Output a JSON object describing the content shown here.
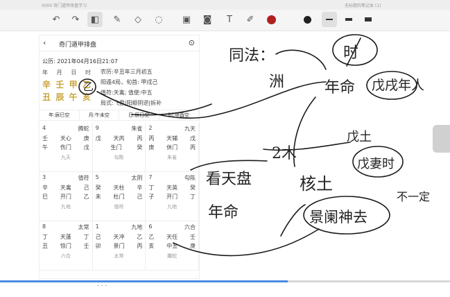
{
  "status_bar": {
    "left_text": "0000 奇门遁甲排盘学习",
    "right_text": "无标题的笔记本 (1)"
  },
  "app": {
    "title": "奇门遁甲排盘",
    "date_line": "公历: 2021年04月16日21:07",
    "pillar_labels": [
      "年",
      "月",
      "日",
      "时"
    ],
    "stems": [
      "辛",
      "壬",
      "甲",
      "乙"
    ],
    "branches": [
      "丑",
      "辰",
      "午",
      "亥"
    ],
    "info_lines": [
      "农历:辛丑年三月初五",
      "阳遁4局，旬首: 甲戌己",
      "值符:天禽; 值使:中五",
      "局式:飞盘|阳顺阴逆|拆补"
    ],
    "kong": [
      "年:辰巳空",
      "月:午未空",
      "日:辰巳空",
      "时:申酉空"
    ],
    "palaces": [
      {
        "num": "4",
        "god": "腾蛇",
        "r2": [
          "壬",
          "天心",
          "庚"
        ],
        "r3": [
          "午",
          "伤门",
          "戊"
        ],
        "foot": "九天"
      },
      {
        "num": "9",
        "god": "朱雀",
        "r2": [
          "戊",
          "天芮",
          "丙"
        ],
        "r3": [
          "",
          "生门",
          "癸"
        ],
        "foot": "勾陈"
      },
      {
        "num": "2",
        "god": "九天",
        "r2": [
          "丙",
          "天辅",
          "戊"
        ],
        "r3": [
          "庚",
          "休门",
          "丙"
        ],
        "foot": "朱雀"
      },
      {
        "num": "3",
        "god": "值符",
        "r2": [
          "辛",
          "天禽",
          "己"
        ],
        "r3": [
          "巳",
          "开门",
          "乙"
        ],
        "foot": "九地"
      },
      {
        "num": "5",
        "god": "太阴",
        "r2": [
          "癸",
          "天柱",
          "辛"
        ],
        "r3": [
          "未",
          "杜门",
          "己"
        ],
        "foot": "值符"
      },
      {
        "num": "7",
        "god": "勾陈",
        "r2": [
          "丁",
          "天英",
          "癸"
        ],
        "r3": [
          "子",
          "开门",
          "丁"
        ],
        "foot": "九地"
      },
      {
        "num": "8",
        "god": "太常",
        "r2": [
          "丁",
          "天蓬",
          "丁"
        ],
        "r3": [
          "丑",
          "惊门",
          "壬"
        ],
        "foot": "六合"
      },
      {
        "num": "1",
        "god": "九地",
        "r2": [
          "己",
          "天冲",
          "乙"
        ],
        "r3": [
          "卯",
          "景门",
          "丙"
        ],
        "foot": "太常"
      },
      {
        "num": "6",
        "god": "六合",
        "r2": [
          "乙",
          "天任",
          "壬"
        ],
        "r3": [
          "亥",
          "中五",
          "庚"
        ],
        "foot": "螣蛇"
      }
    ]
  },
  "handwriting": {
    "tongfa": "同法：",
    "ran": "洲",
    "shishi": "时",
    "nianming": "年命",
    "wuxu": "戊戌年人",
    "wutu": "戊土",
    "ermu": "2木",
    "hetu": "核土",
    "wuqishi": "戊妻时",
    "kantian": "看天盘",
    "nianming2": "年命",
    "jingmenshen": "景阑神去",
    "buhao": "不一定",
    "small_marks": "乙"
  },
  "video": {
    "progress_percent": 64
  }
}
